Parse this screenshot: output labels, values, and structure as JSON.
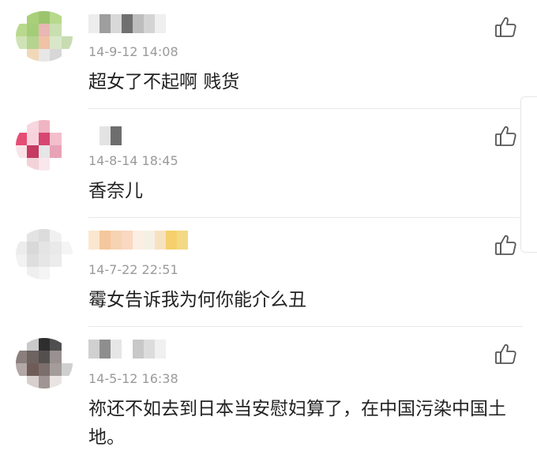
{
  "comments": [
    {
      "time": "14-9-12 14:08",
      "text": "超女了不起啊 贱货",
      "avatar_colors": [
        "#ffffff",
        "#a9cf7a",
        "#9bc46d",
        "#b6d98c",
        "#ffffff",
        "#b8d98e",
        "#a5cd78",
        "#e9b7b4",
        "#c9dfb0",
        "#ffffff",
        "#cfe3b6",
        "#b5d48f",
        "#f0c2a6",
        "#d9e7c9",
        "#c7dcb1",
        "#ffffff",
        "#f1d8b8",
        "#e7e7e7",
        "#d7d7d7",
        "#ffffff"
      ],
      "name_colors": [
        "#ededed",
        "#9e9e9e",
        "#d9d9d9",
        "#707070",
        "#bdbdbd",
        "#d4d4d4",
        "#efefef"
      ]
    },
    {
      "time": "14-8-14 18:45",
      "text": "香奈儿",
      "avatar_colors": [
        "#ffffff",
        "#f7d6dd",
        "#f0b4c2",
        "#ffffff",
        "#ffffff",
        "#e54d75",
        "#f7d4dd",
        "#d74670",
        "#f3bfcc",
        "#ffffff",
        "#f9e3e8",
        "#c53b62",
        "#e6e6e6",
        "#e8a3b6",
        "#ffffff",
        "#ffffff",
        "#f4d2da",
        "#f9e7ec",
        "#ffffff",
        "#ffffff"
      ],
      "name_colors": [
        "#ffffff",
        "#e3e3e3",
        "#6e6e6e"
      ]
    },
    {
      "time": "14-7-22 22:51",
      "text": "霉女告诉我为何你能介么丑",
      "avatar_colors": [
        "#ffffff",
        "#e3e3e3",
        "#dcdcdc",
        "#f0f0f0",
        "#ffffff",
        "#ececec",
        "#d9d9d9",
        "#e4e4e4",
        "#e9e9e9",
        "#f4f4f4",
        "#f2f2f2",
        "#dedede",
        "#e6e6e6",
        "#ececec",
        "#ffffff",
        "#ffffff",
        "#efefef",
        "#f4f4f4",
        "#ffffff",
        "#ffffff"
      ],
      "name_colors": [
        "#fbe6cf",
        "#f4c79c",
        "#f6d3b2",
        "#fad8c0",
        "#fbeee2",
        "#f5f0e4",
        "#f7e2c0",
        "#f5d06c",
        "#f3d985"
      ]
    },
    {
      "time": "14-5-12 16:38",
      "text": "祢还不如去到日本当安慰妇算了，在中国污染中国土地。",
      "avatar_colors": [
        "#ffffff",
        "#c9c9c9",
        "#2e2e2e",
        "#4f4f4f",
        "#ffffff",
        "#8a7f7d",
        "#6e6361",
        "#555050",
        "#9a9090",
        "#ffffff",
        "#b2a8a5",
        "#6f5c59",
        "#7c6e6b",
        "#a49c9a",
        "#cfcfcf",
        "#ffffff",
        "#d8d0ce",
        "#a09593",
        "#e9e4e3",
        "#ffffff"
      ],
      "name_colors": [
        "#d0d0d0",
        "#8e8e8e",
        "#e6e6e6",
        "#ffffff",
        "#c8c8c8",
        "#dcdcdc",
        "#f0f0f0"
      ]
    }
  ]
}
